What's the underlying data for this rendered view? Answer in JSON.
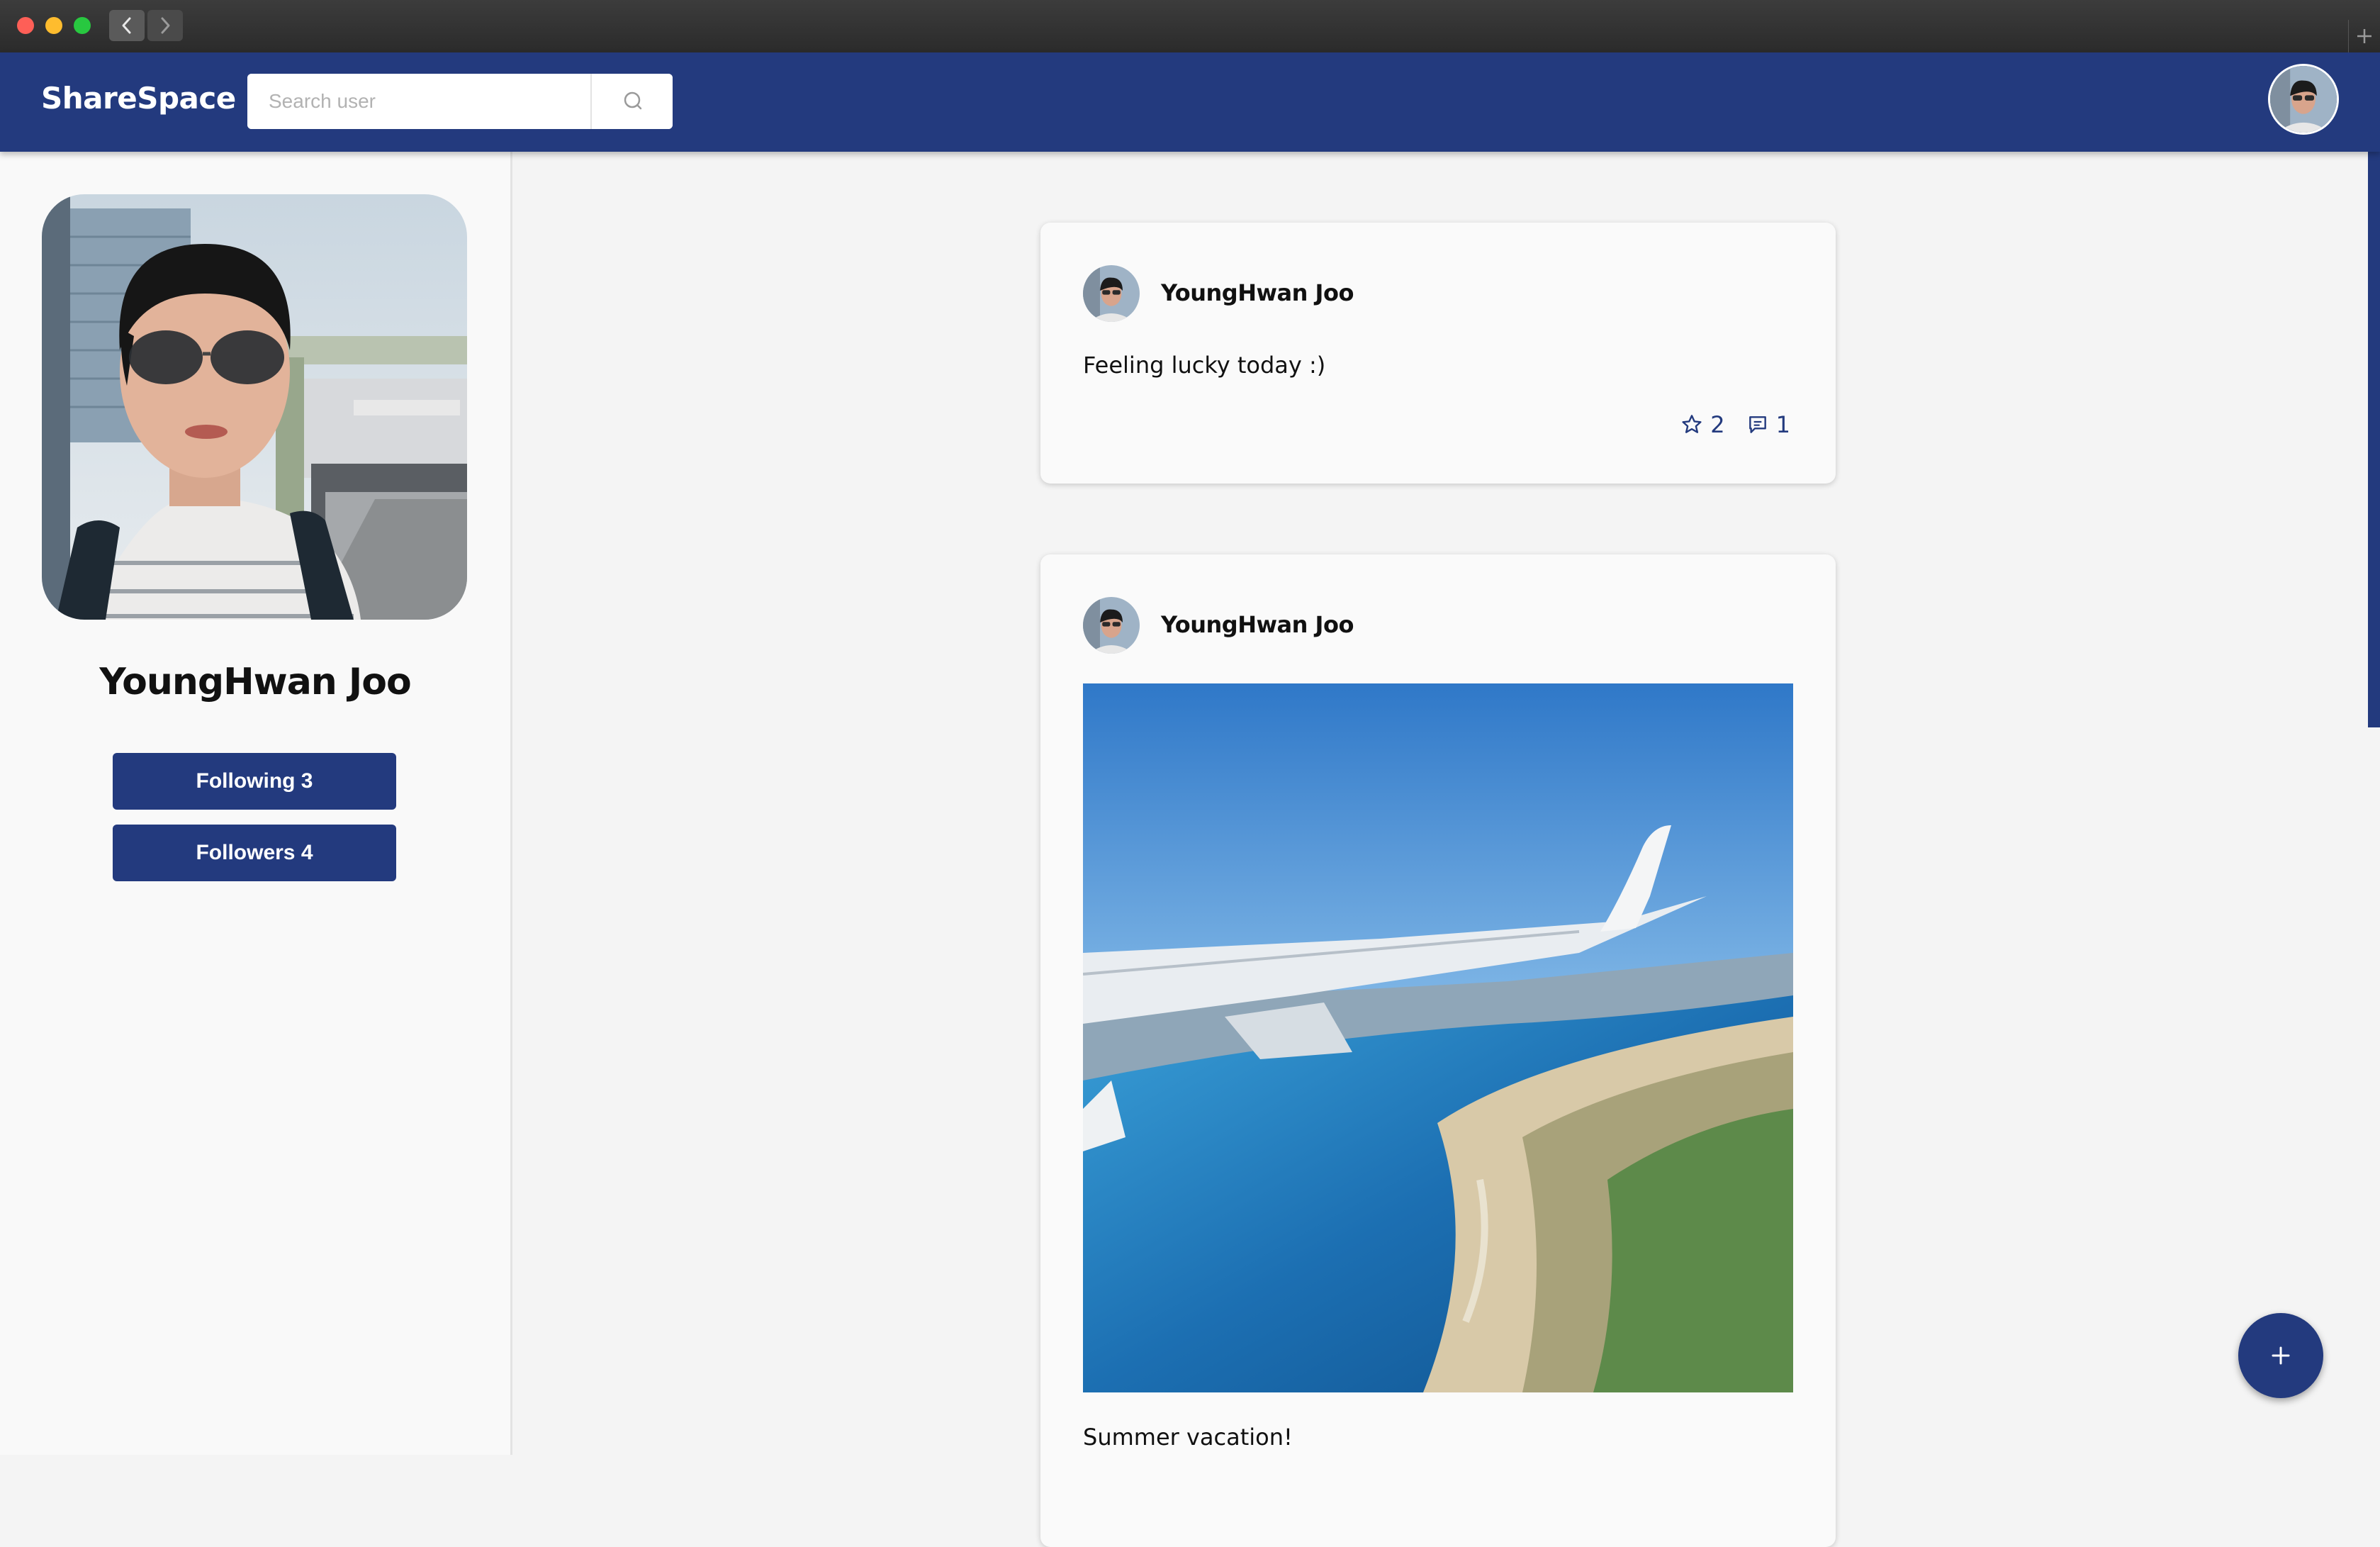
{
  "app": {
    "brand": "ShareSpace"
  },
  "search": {
    "placeholder": "Search user"
  },
  "profile": {
    "name": "YoungHwan Joo",
    "following_label": "Following 3",
    "followers_label": "Followers 4"
  },
  "posts": [
    {
      "author": "YoungHwan Joo",
      "text": "Feeling lucky today :)",
      "stars": "2",
      "comments": "1"
    },
    {
      "author": "YoungHwan Joo",
      "caption": "Summer vacation!"
    }
  ],
  "colors": {
    "primary": "#233a7e",
    "background": "#f4f4f4",
    "sidebar": "#f9f9f9"
  },
  "icons": [
    "search-icon",
    "star-icon",
    "comment-icon",
    "plus-icon",
    "chevron-left-icon",
    "chevron-right-icon"
  ]
}
